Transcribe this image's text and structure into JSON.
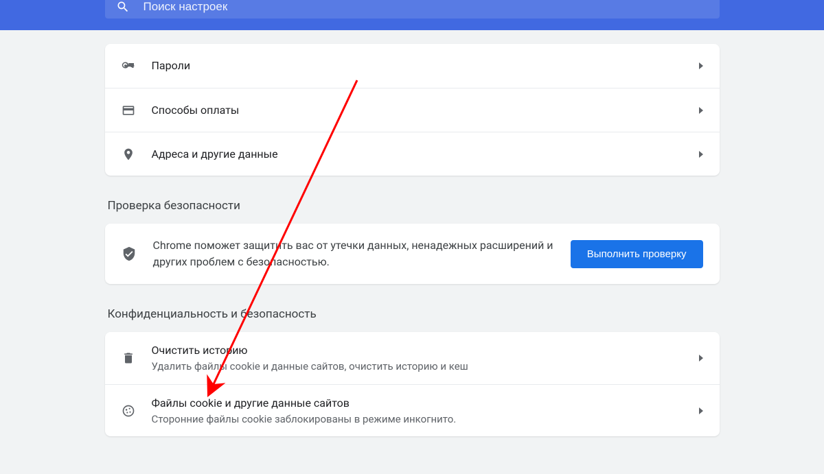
{
  "search": {
    "placeholder": "Поиск настроек"
  },
  "autofill": {
    "rows": [
      {
        "title": "Пароли"
      },
      {
        "title": "Способы оплаты"
      },
      {
        "title": "Адреса и другие данные"
      }
    ]
  },
  "safety": {
    "heading": "Проверка безопасности",
    "description": "Chrome поможет защитить вас от утечки данных, ненадежных расширений и других проблем с безопасностью.",
    "button": "Выполнить проверку"
  },
  "privacy": {
    "heading": "Конфиденциальность и безопасность",
    "rows": [
      {
        "title": "Очистить историю",
        "sub": "Удалить файлы cookie и данные сайтов, очистить историю и кеш"
      },
      {
        "title": "Файлы cookie и другие данные сайтов",
        "sub": "Сторонние файлы cookie заблокированы в режиме инкогнито."
      }
    ]
  }
}
